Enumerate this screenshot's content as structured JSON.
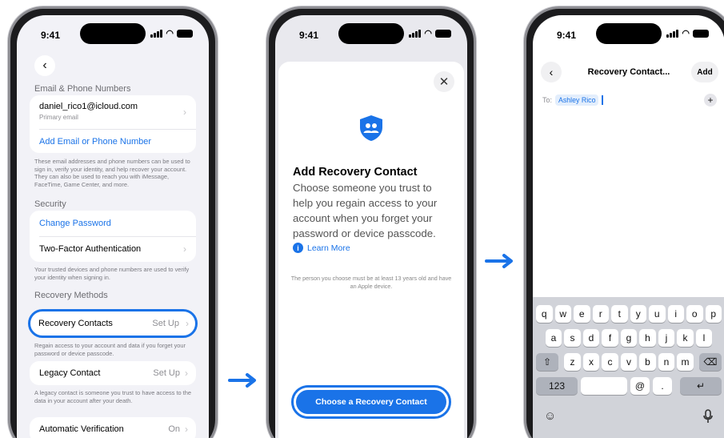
{
  "colors": {
    "accent": "#1a73e8"
  },
  "status": {
    "time": "9:41"
  },
  "screen1": {
    "back_icon": "chevron-left-icon",
    "email_section": "Email & Phone Numbers",
    "email": "daniel_rico1@icloud.com",
    "email_sub": "Primary email",
    "add_email": "Add Email or Phone Number",
    "email_note": "These email addresses and phone numbers can be used to sign in, verify your identity, and help recover your account. They can also be used to reach you with iMessage, FaceTime, Game Center, and more.",
    "security_section": "Security",
    "change_password": "Change Password",
    "two_factor": "Two-Factor Authentication",
    "security_note": "Your trusted devices and phone numbers are used to verify your identity when signing in.",
    "recovery_section": "Recovery Methods",
    "recovery_contacts": "Recovery Contacts",
    "recovery_value": "Set Up",
    "recovery_note": "Regain access to your account and data if you forget your password or device passcode.",
    "legacy_contact": "Legacy Contact",
    "legacy_value": "Set Up",
    "legacy_note": "A legacy contact is someone you trust to have access to the data in your account after your death.",
    "auto_verify": "Automatic Verification",
    "auto_verify_value": "On"
  },
  "screen2": {
    "close_icon": "close-icon",
    "title": "Add Recovery Contact",
    "body": "Choose someone you trust to help you regain access to your account when you forget your password or device passcode.",
    "learn_more": "Learn More",
    "fine_print": "The person you choose must be at least 13 years old and have an Apple device.",
    "choose_button": "Choose a Recovery Contact"
  },
  "screen3": {
    "title": "Recovery Contact...",
    "add": "Add",
    "to_label": "To:",
    "recipient": "Ashley Rico",
    "keyboard": {
      "row1": [
        "q",
        "w",
        "e",
        "r",
        "t",
        "y",
        "u",
        "i",
        "o",
        "p"
      ],
      "row2": [
        "a",
        "s",
        "d",
        "f",
        "g",
        "h",
        "j",
        "k",
        "l"
      ],
      "row3": [
        "z",
        "x",
        "c",
        "v",
        "b",
        "n",
        "m"
      ],
      "numbers": "123",
      "at": "@",
      "dot": "."
    }
  }
}
